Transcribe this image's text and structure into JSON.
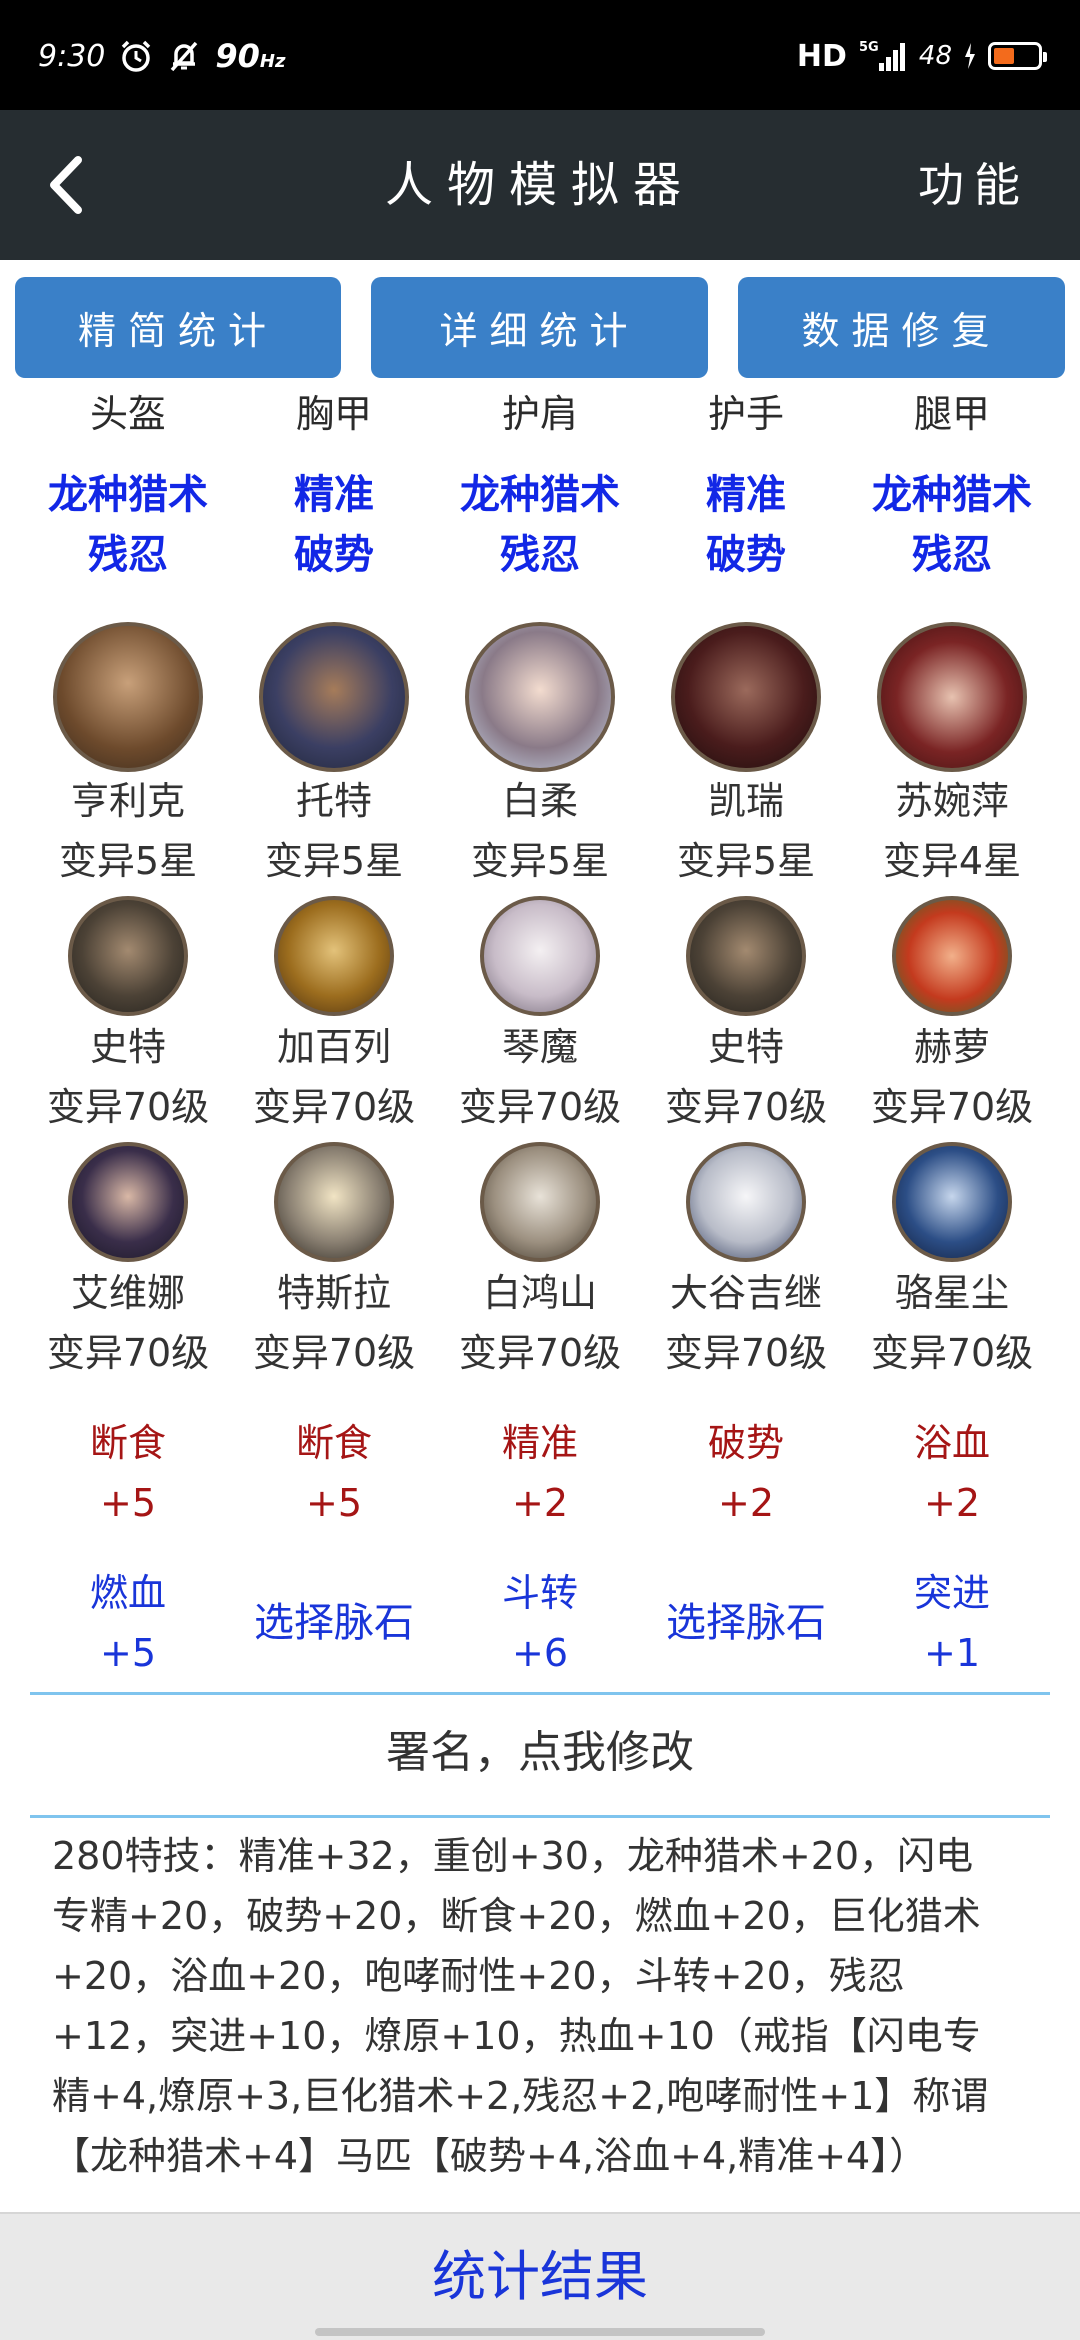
{
  "status_bar": {
    "time": "9:30",
    "refresh_rate": "90",
    "refresh_unit": "Hz",
    "hd": "HD",
    "network": "5G",
    "battery_text": "48",
    "battery_level": 0.48,
    "battery_color": "#f36b1c"
  },
  "appbar": {
    "title": "人物模拟器",
    "function_label": "功能",
    "bg_color": "#262d31"
  },
  "tabs": [
    {
      "label": "精简统计"
    },
    {
      "label": "详细统计"
    },
    {
      "label": "数据修复"
    }
  ],
  "accent_color": "#3a80c8",
  "equipment": [
    {
      "slot": "头盔",
      "skill1": "龙种猎术",
      "skill2": "残忍"
    },
    {
      "slot": "胸甲",
      "skill1": "精准",
      "skill2": "破势"
    },
    {
      "slot": "护肩",
      "skill1": "龙种猎术",
      "skill2": "残忍"
    },
    {
      "slot": "护手",
      "skill1": "精准",
      "skill2": "破势"
    },
    {
      "slot": "腿甲",
      "skill1": "龙种猎术",
      "skill2": "残忍"
    }
  ],
  "main_heroes": [
    {
      "name": "亨利克",
      "level": "变异5星"
    },
    {
      "name": "托特",
      "level": "变异5星"
    },
    {
      "name": "白柔",
      "level": "变异5星"
    },
    {
      "name": "凯瑞",
      "level": "变异5星"
    },
    {
      "name": "苏婉萍",
      "level": "变异4星"
    }
  ],
  "sub_heroes_row1": [
    {
      "name": "史特",
      "level": "变异70级"
    },
    {
      "name": "加百列",
      "level": "变异70级"
    },
    {
      "name": "琴魔",
      "level": "变异70级"
    },
    {
      "name": "史特",
      "level": "变异70级"
    },
    {
      "name": "赫萝",
      "level": "变异70级"
    }
  ],
  "sub_heroes_row2": [
    {
      "name": "艾维娜",
      "level": "变异70级"
    },
    {
      "name": "特斯拉",
      "level": "变异70级"
    },
    {
      "name": "白鸿山",
      "level": "变异70级"
    },
    {
      "name": "大谷吉继",
      "level": "变异70级"
    },
    {
      "name": "骆星尘",
      "level": "变异70级"
    }
  ],
  "vein_stones_red": [
    {
      "name": "断食",
      "value": "+5"
    },
    {
      "name": "断食",
      "value": "+5"
    },
    {
      "name": "精准",
      "value": "+2"
    },
    {
      "name": "破势",
      "value": "+2"
    },
    {
      "name": "浴血",
      "value": "+2"
    }
  ],
  "vein_stones_blue": [
    {
      "name": "燃血",
      "value": "+5"
    },
    {
      "choose": "选择脉石"
    },
    {
      "name": "斗转",
      "value": "+6"
    },
    {
      "choose": "选择脉石"
    },
    {
      "name": "突进",
      "value": "+1"
    }
  ],
  "signature": "署名，点我修改",
  "summary_lines": [
    "280特技：精准+32，重创+30，龙种猎术+20，闪电",
    "专精+20，破势+20，断食+20，燃血+20，巨化猎术",
    "+20，浴血+20，咆哮耐性+20，斗转+20，残忍",
    "+12，突进+10，燎原+10，热血+10（戒指【闪电专",
    "精+4,燎原+3,巨化猎术+2,残忍+2,咆哮耐性+1】称谓",
    "【龙种猎术+4】马匹【破势+4,浴血+4,精准+4】）"
  ],
  "bottom_button": "统计结果"
}
